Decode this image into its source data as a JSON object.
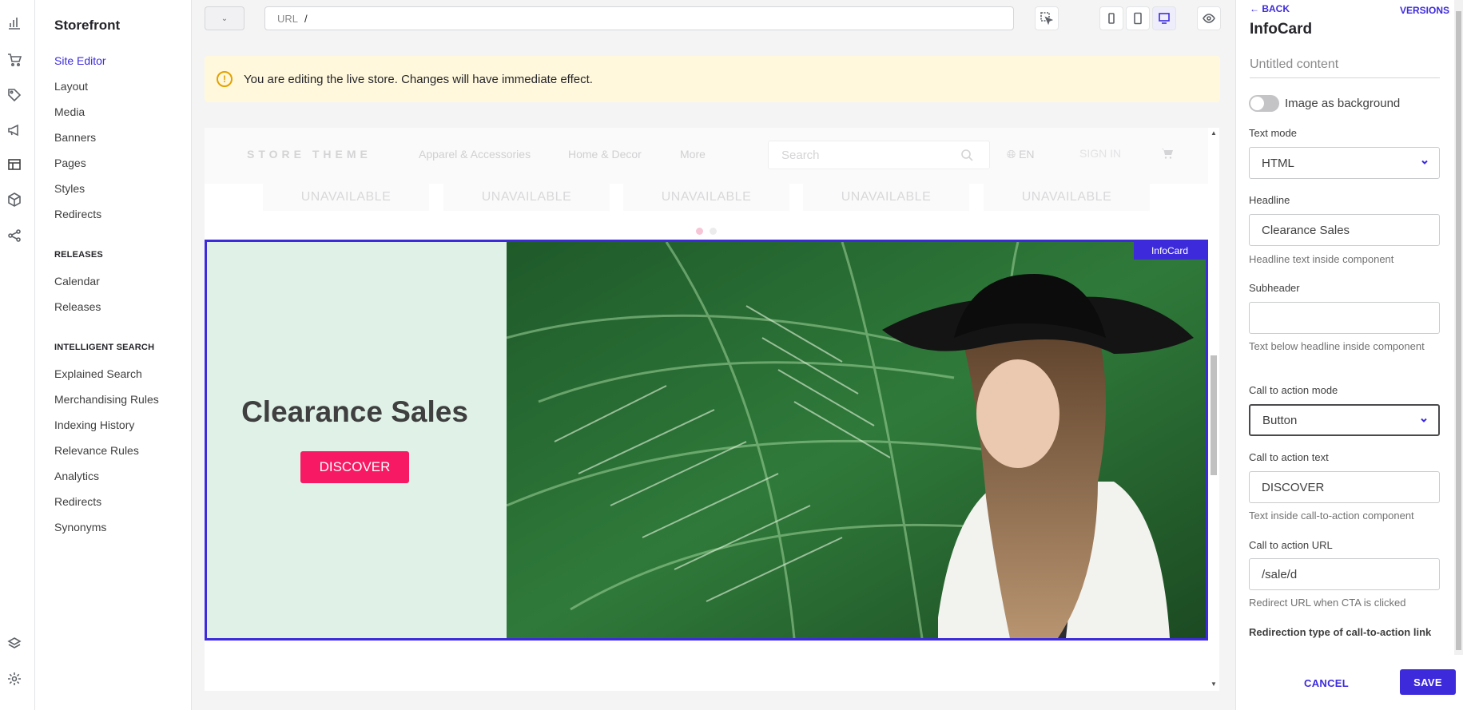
{
  "app": {
    "title": "Storefront"
  },
  "sidebar": {
    "items": [
      {
        "label": "Site Editor",
        "active": true
      },
      {
        "label": "Layout"
      },
      {
        "label": "Media"
      },
      {
        "label": "Banners"
      },
      {
        "label": "Pages"
      },
      {
        "label": "Styles"
      },
      {
        "label": "Redirects"
      }
    ],
    "releases": {
      "heading": "RELEASES",
      "items": [
        {
          "label": "Calendar"
        },
        {
          "label": "Releases"
        }
      ]
    },
    "search": {
      "heading": "INTELLIGENT SEARCH",
      "items": [
        {
          "label": "Explained Search"
        },
        {
          "label": "Merchandising Rules"
        },
        {
          "label": "Indexing History"
        },
        {
          "label": "Relevance Rules"
        },
        {
          "label": "Analytics"
        },
        {
          "label": "Redirects"
        },
        {
          "label": "Synonyms"
        }
      ]
    }
  },
  "rail": {
    "icons": [
      "bar-chart-icon",
      "cart-icon",
      "tag-icon",
      "megaphone-icon",
      "layout-icon",
      "box-icon",
      "share-icon",
      "layers-icon",
      "gear-icon"
    ]
  },
  "toolbar": {
    "url_label": "URL",
    "url_value": "/",
    "devices": [
      "mobile-icon",
      "tablet-icon",
      "desktop-icon"
    ],
    "active_device": "desktop-icon"
  },
  "alert": {
    "icon": "!",
    "text": "You are editing the live store. Changes will have immediate effect."
  },
  "store": {
    "logo": "STORE THEME",
    "menu": [
      "Apparel & Accessories",
      "Home & Decor",
      "More"
    ],
    "search_placeholder": "Search",
    "language": "EN",
    "signin": "SIGN IN",
    "unavailable": [
      "UNAVAILABLE",
      "UNAVAILABLE",
      "UNAVAILABLE",
      "UNAVAILABLE",
      "UNAVAILABLE"
    ]
  },
  "infocard": {
    "tag": "InfoCard",
    "headline": "Clearance Sales",
    "cta": "DISCOVER"
  },
  "panel": {
    "back": "BACK",
    "versions": "VERSIONS",
    "title": "InfoCard",
    "untitled": "Untitled content",
    "image_bg_label": "Image as background",
    "image_bg_on": false,
    "text_mode_label": "Text mode",
    "text_mode_value": "HTML",
    "headline_label": "Headline",
    "headline_value": "Clearance Sales",
    "headline_help": "Headline text inside component",
    "subheader_label": "Subheader",
    "subheader_value": "",
    "subheader_help": "Text below headline inside component",
    "cta_mode_label": "Call to action mode",
    "cta_mode_value": "Button",
    "cta_text_label": "Call to action text",
    "cta_text_value": "DISCOVER",
    "cta_text_help": "Text inside call-to-action component",
    "cta_url_label": "Call to action URL",
    "cta_url_value": "/sale/d",
    "cta_url_help": "Redirect URL when CTA is clicked",
    "redirect_label": "Redirection type of call-to-action link",
    "cancel": "CANCEL",
    "save": "SAVE"
  },
  "colors": {
    "accent": "#3d2bdb",
    "cta": "#f71963",
    "card_bg": "#e0f2e7",
    "alert_bg": "#fff8dc"
  }
}
